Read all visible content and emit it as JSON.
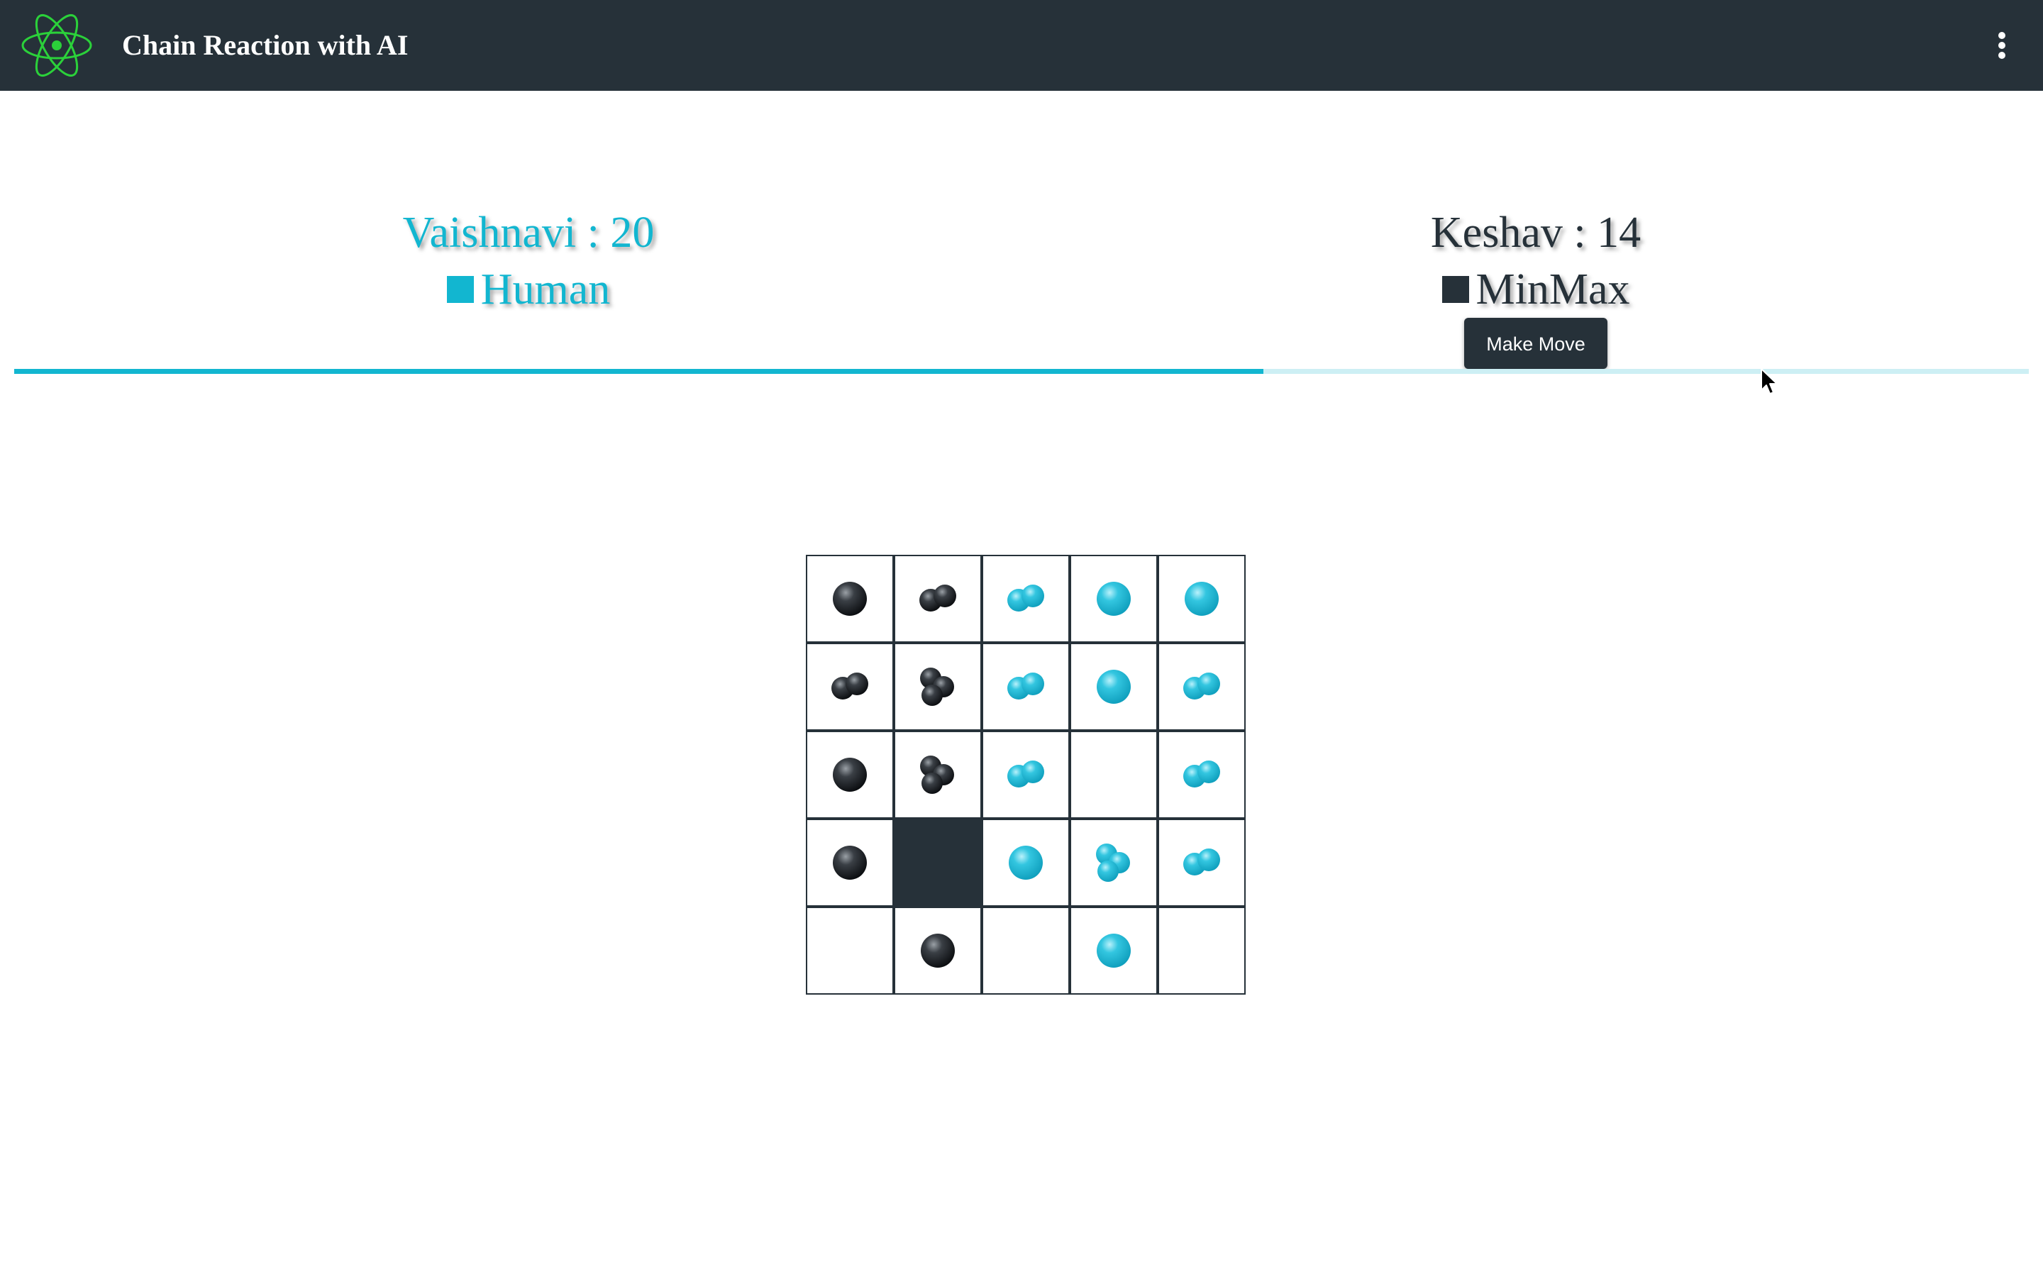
{
  "header": {
    "title": "Chain Reaction with AI",
    "logo_icon": "atom-icon",
    "menu_icon": "more-vertical-icon",
    "logo_color": "#2bd13a"
  },
  "players": [
    {
      "name": "Vaishnavi",
      "score": 20,
      "score_text": "Vaishnavi : 20",
      "type": "Human",
      "color": "#12b6d0"
    },
    {
      "name": "Keshav",
      "score": 14,
      "score_text": "Keshav : 14",
      "type": "MinMax",
      "color": "#263139"
    }
  ],
  "actions": {
    "make_move_label": "Make Move"
  },
  "turn_progress": 0.62,
  "board": {
    "rows": 5,
    "cols": 5,
    "cells": [
      [
        {
          "owner": "dark",
          "orbs": 1
        },
        {
          "owner": "dark",
          "orbs": 2
        },
        {
          "owner": "cyan",
          "orbs": 2
        },
        {
          "owner": "cyan",
          "orbs": 1
        },
        {
          "owner": "cyan",
          "orbs": 1
        }
      ],
      [
        {
          "owner": "dark",
          "orbs": 2
        },
        {
          "owner": "dark",
          "orbs": 3
        },
        {
          "owner": "cyan",
          "orbs": 2
        },
        {
          "owner": "cyan",
          "orbs": 1
        },
        {
          "owner": "cyan",
          "orbs": 2
        }
      ],
      [
        {
          "owner": "dark",
          "orbs": 1
        },
        {
          "owner": "dark",
          "orbs": 3
        },
        {
          "owner": "cyan",
          "orbs": 2
        },
        {
          "owner": "none",
          "orbs": 0
        },
        {
          "owner": "cyan",
          "orbs": 2
        }
      ],
      [
        {
          "owner": "dark",
          "orbs": 1
        },
        {
          "owner": "blocked",
          "orbs": 0
        },
        {
          "owner": "cyan",
          "orbs": 1
        },
        {
          "owner": "cyan",
          "orbs": 3
        },
        {
          "owner": "cyan",
          "orbs": 2
        }
      ],
      [
        {
          "owner": "none",
          "orbs": 0
        },
        {
          "owner": "dark",
          "orbs": 1
        },
        {
          "owner": "none",
          "orbs": 0
        },
        {
          "owner": "cyan",
          "orbs": 1
        },
        {
          "owner": "none",
          "orbs": 0
        }
      ]
    ]
  }
}
